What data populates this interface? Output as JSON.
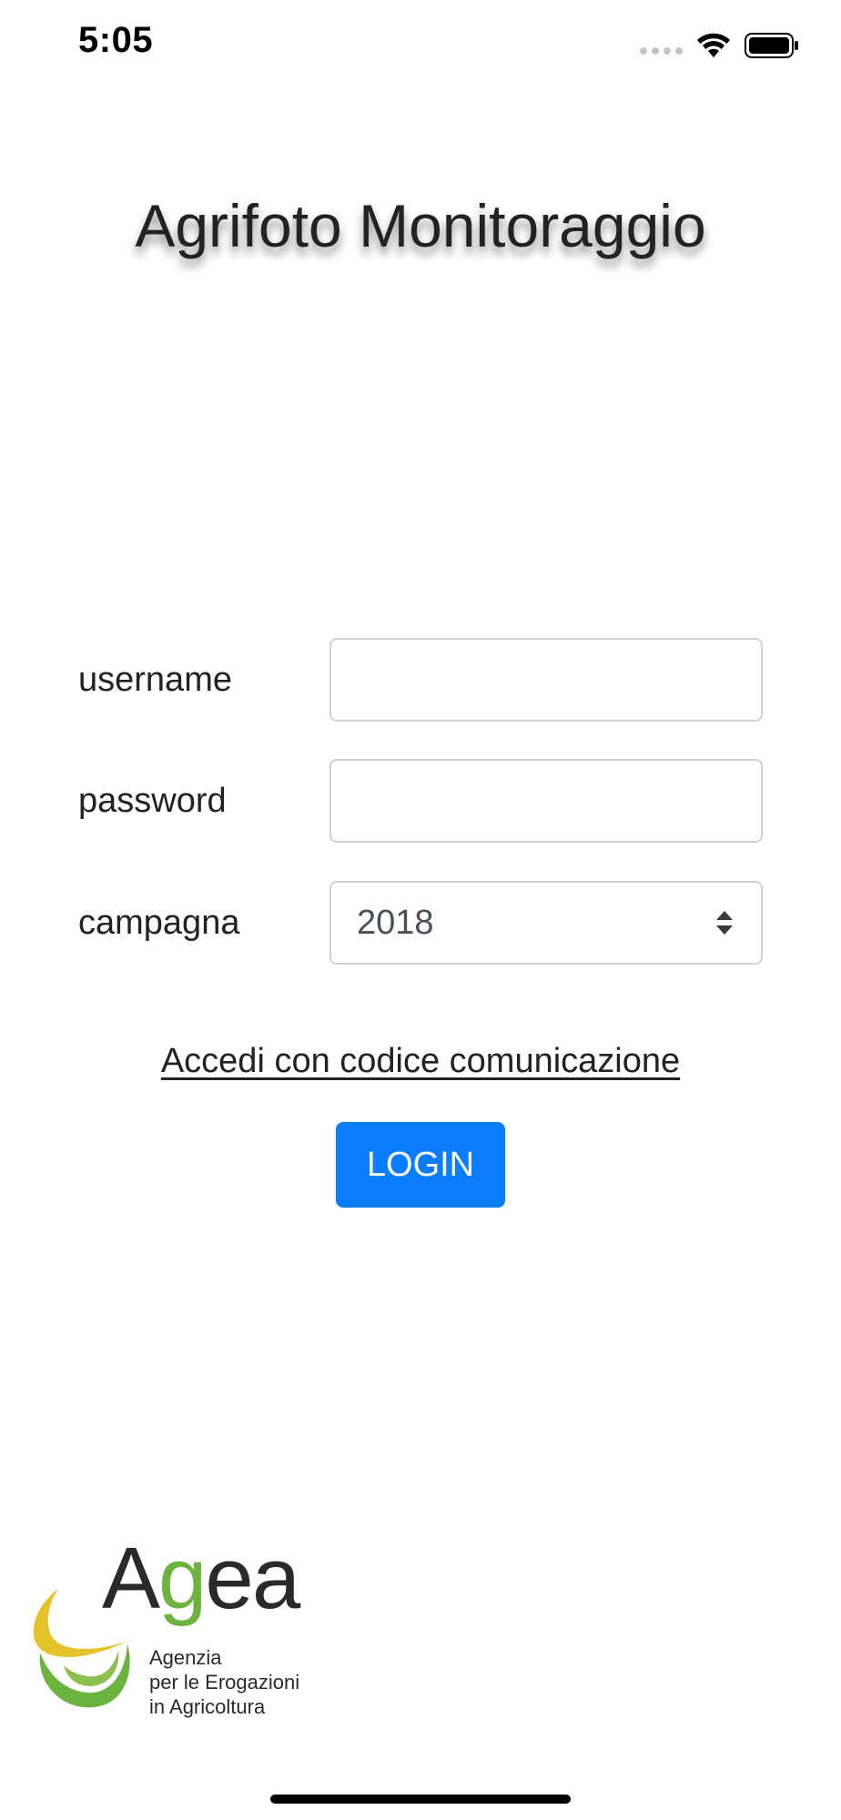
{
  "status_bar": {
    "time": "5:05"
  },
  "app": {
    "title": "Agrifoto Monitoraggio"
  },
  "form": {
    "username_label": "username",
    "username_value": "",
    "password_label": "password",
    "password_value": "",
    "campaign_label": "campagna",
    "campaign_value": "2018"
  },
  "actions": {
    "alt_login_link": "Accedi con codice comunicazione",
    "login_button": "LOGIN",
    "login_button_color": "#0a7dff"
  },
  "logo": {
    "word": "Agea",
    "subtitle_lines": [
      "Agenzia",
      "per le Erogazioni",
      "in Agricoltura"
    ],
    "colors": {
      "yellow": "#e5c42b",
      "green": "#6db33f"
    }
  },
  "icons": [
    "signal-dots-icon",
    "wifi-icon",
    "battery-icon",
    "select-arrows-icon"
  ]
}
